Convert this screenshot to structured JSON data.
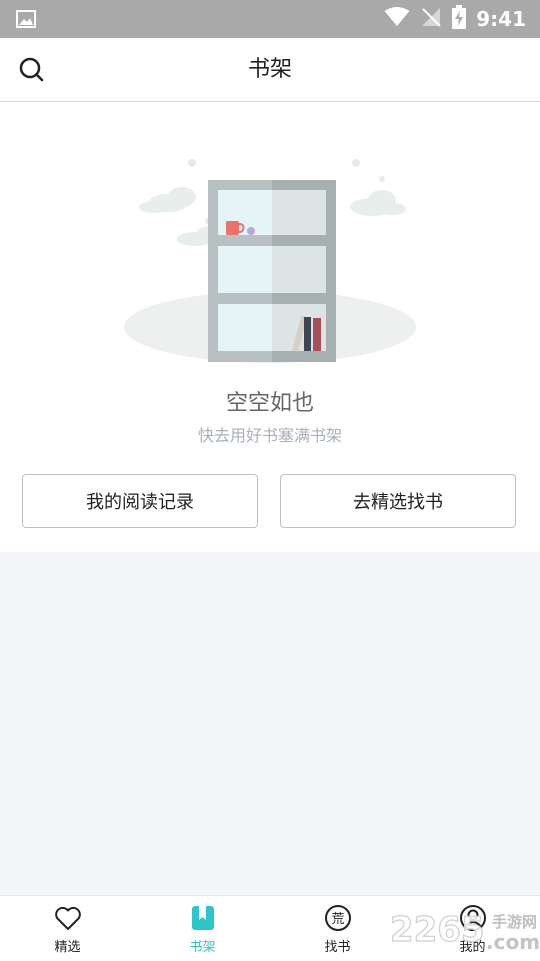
{
  "status_bar": {
    "time": "9:41"
  },
  "header": {
    "title": "书架"
  },
  "empty_state": {
    "title": "空空如也",
    "subtitle": "快去用好书塞满书架"
  },
  "actions": {
    "history_label": "我的阅读记录",
    "browse_label": "去精选找书"
  },
  "tabs": [
    {
      "label": "精选",
      "icon": "heart-icon"
    },
    {
      "label": "书架",
      "icon": "bookshelf-icon",
      "active": true
    },
    {
      "label": "找书",
      "icon": "find-book-icon",
      "badge_char": "荒"
    },
    {
      "label": "我的",
      "icon": "user-icon"
    }
  ],
  "watermark": {
    "number": "2265",
    "domain": ".com",
    "text": "手游网"
  },
  "colors": {
    "accent": "#2cc7c9",
    "status_bar": "#a9a9a9",
    "background": "#f4f5f9"
  }
}
